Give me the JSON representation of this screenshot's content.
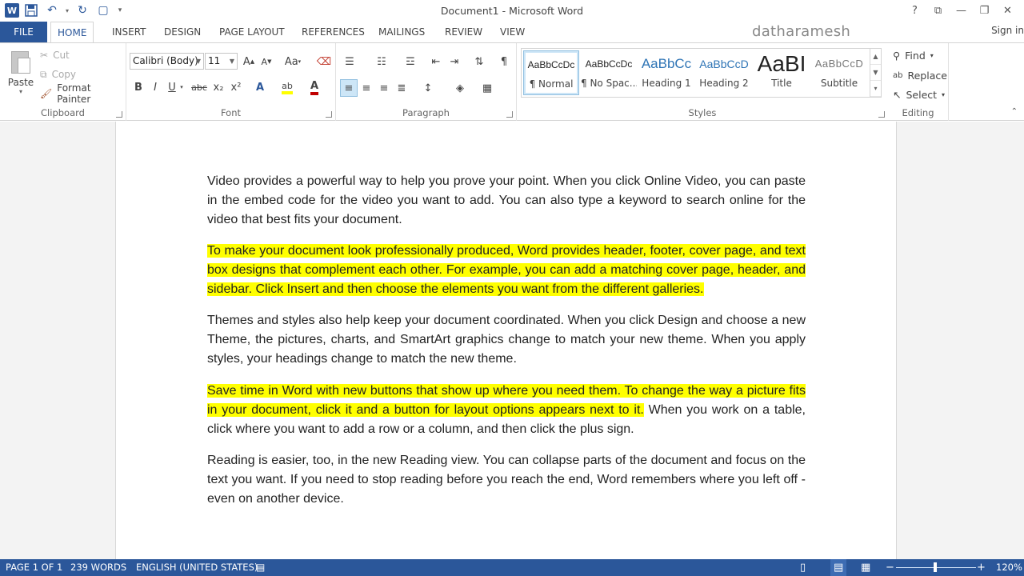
{
  "window": {
    "title": "Document1 - Microsoft Word",
    "controls": [
      "?",
      "⧉",
      "—",
      "❐",
      "✕"
    ]
  },
  "tabs": {
    "file": "FILE",
    "items": [
      "HOME",
      "INSERT",
      "DESIGN",
      "PAGE LAYOUT",
      "REFERENCES",
      "MAILINGS",
      "REVIEW",
      "VIEW"
    ],
    "active": "HOME",
    "user": "datharamesh",
    "signin": "Sign in"
  },
  "clipboard": {
    "label": "Clipboard",
    "paste": "Paste",
    "cut": "Cut",
    "copy": "Copy",
    "format_painter": "Format Painter"
  },
  "font": {
    "label": "Font",
    "family": "Calibri (Body)",
    "size": "11",
    "grow": "A",
    "shrink": "A",
    "case": "Aa",
    "bold": "B",
    "italic": "I",
    "underline": "U",
    "strike": "abc",
    "subscript": "x₂",
    "superscript": "x²"
  },
  "paragraph": {
    "label": "Paragraph",
    "pilcrow": "¶"
  },
  "styles": {
    "label": "Styles",
    "items": [
      {
        "sample": "AaBbCcDc",
        "name": "¶ Normal"
      },
      {
        "sample": "AaBbCcDc",
        "name": "¶ No Spac..."
      },
      {
        "sample": "AaBbCc",
        "name": "Heading 1"
      },
      {
        "sample": "AaBbCcD",
        "name": "Heading 2"
      },
      {
        "sample": "AaBI",
        "name": "Title"
      },
      {
        "sample": "AaBbCcD",
        "name": "Subtitle"
      }
    ]
  },
  "editing": {
    "label": "Editing",
    "find": "Find",
    "replace": "Replace",
    "select": "Select"
  },
  "document": {
    "p1": "Video provides a powerful way to help you prove your point. When you click Online Video, you can paste in the embed code for the video you want to add. You can also type a keyword to search online for the video that best fits your document.",
    "p2": "To make your document look professionally produced, Word provides header, footer, cover page, and text box designs that complement each other. For example, you can add a matching cover page, header, and sidebar. Click Insert and then choose the elements you want from the different galleries.",
    "p3": "Themes and styles also help keep your document coordinated. When you click Design and choose a new Theme, the pictures, charts, and SmartArt graphics change to match your new theme. When you apply styles, your headings change to match the new theme.",
    "p4_highlight": "Save time in Word with new buttons that show up where you need them. To change the way a picture fits in your document, click it and a button for layout options appears next to it.",
    "p4_rest": " When you work on a table, click where you want to add a row or a column, and then click the plus sign.",
    "p5": "Reading is easier, too, in the new Reading view. You can collapse parts of the document and focus on the text you want. If you need to stop reading before you reach the end, Word remembers where you left off - even on another device."
  },
  "status": {
    "page": "PAGE 1 OF 1",
    "words": "239 WORDS",
    "language": "ENGLISH (UNITED STATES)",
    "zoom_minus": "−",
    "zoom_plus": "+",
    "zoom": "120%"
  },
  "colors": {
    "accent": "#2b579a",
    "highlight": "#ffff00"
  }
}
